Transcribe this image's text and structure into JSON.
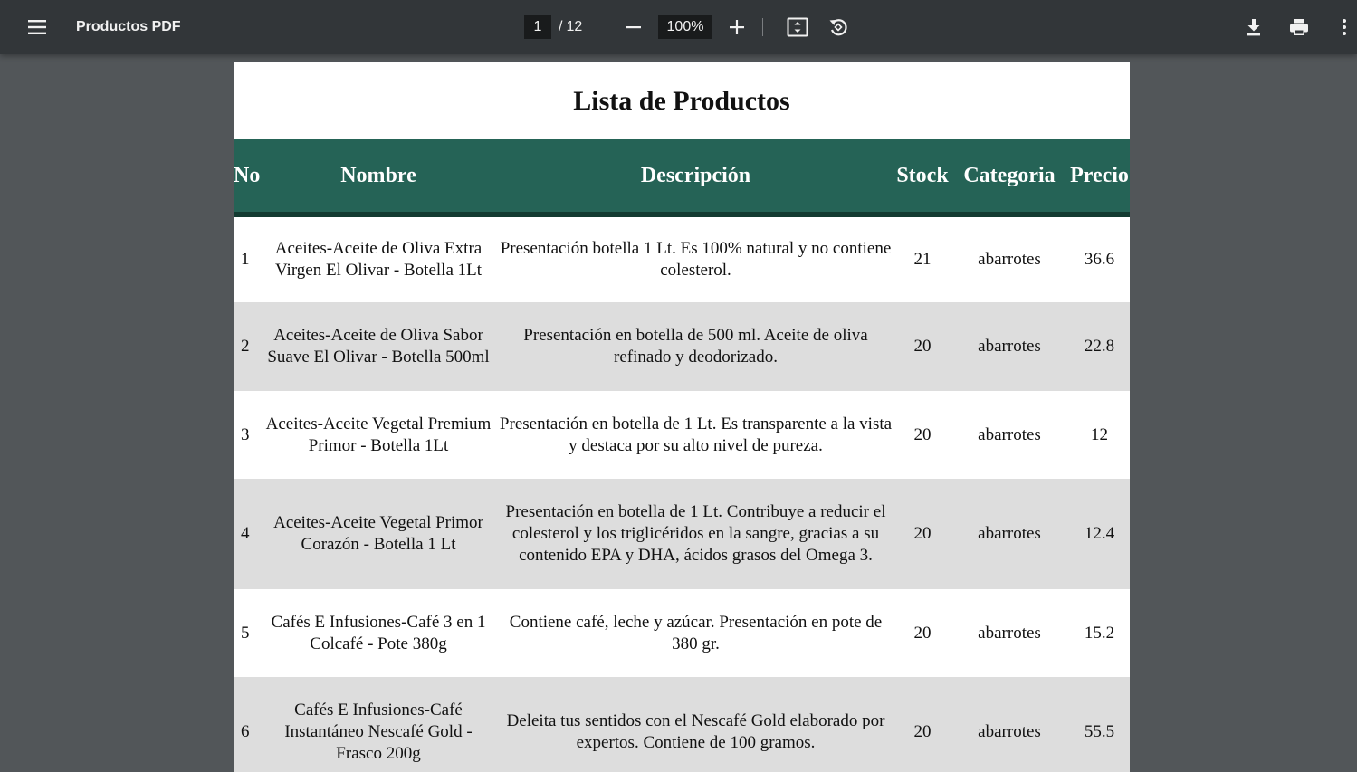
{
  "toolbar": {
    "title": "Productos PDF",
    "current_page": "1",
    "page_separator": "/",
    "total_pages": "12",
    "zoom": "100%",
    "icons": {
      "menu": "menu-icon",
      "zoom_out": "minus-icon",
      "zoom_in": "plus-icon",
      "fit": "fit-to-page-icon",
      "rotate": "rotate-icon",
      "download": "download-icon",
      "print": "print-icon",
      "more": "more-vert-icon"
    }
  },
  "document": {
    "title": "Lista de Productos",
    "columns": [
      "No",
      "Nombre",
      "Descripción",
      "Stock",
      "Categoria",
      "Precio"
    ],
    "rows": [
      {
        "no": "1",
        "nombre": "Aceites-Aceite de Oliva Extra Virgen El Olivar - Botella 1Lt",
        "descripcion": "Presentación botella 1 Lt. Es 100% natural y no contiene colesterol.",
        "stock": "21",
        "categoria": "abarrotes",
        "precio": "36.6"
      },
      {
        "no": "2",
        "nombre": "Aceites-Aceite de Oliva Sabor Suave El Olivar - Botella 500ml",
        "descripcion": "Presentación en botella de 500 ml. Aceite de oliva refinado y deodorizado.",
        "stock": "20",
        "categoria": "abarrotes",
        "precio": "22.8"
      },
      {
        "no": "3",
        "nombre": "Aceites-Aceite Vegetal Premium Primor - Botella 1Lt",
        "descripcion": "Presentación en botella de 1 Lt. Es transparente a la vista y destaca por su alto nivel de pureza.",
        "stock": "20",
        "categoria": "abarrotes",
        "precio": "12"
      },
      {
        "no": "4",
        "nombre": "Aceites-Aceite Vegetal Primor Corazón - Botella 1 Lt",
        "descripcion": "Presentación en botella de 1 Lt. Contribuye a reducir el colesterol y los triglicéridos en la sangre, gracias a su contenido EPA y DHA, ácidos grasos del Omega 3.",
        "stock": "20",
        "categoria": "abarrotes",
        "precio": "12.4"
      },
      {
        "no": "5",
        "nombre": "Cafés E Infusiones-Café 3 en 1 Colcafé - Pote 380g",
        "descripcion": "Contiene café, leche y azúcar. Presentación en pote de 380 gr.",
        "stock": "20",
        "categoria": "abarrotes",
        "precio": "15.2"
      },
      {
        "no": "6",
        "nombre": "Cafés E Infusiones-Café Instantáneo Nescafé Gold - Frasco 200g",
        "descripcion": "Deleita tus sentidos con el Nescafé Gold elaborado por expertos. Contiene de 100 gramos.",
        "stock": "20",
        "categoria": "abarrotes",
        "precio": "55.5"
      }
    ]
  }
}
